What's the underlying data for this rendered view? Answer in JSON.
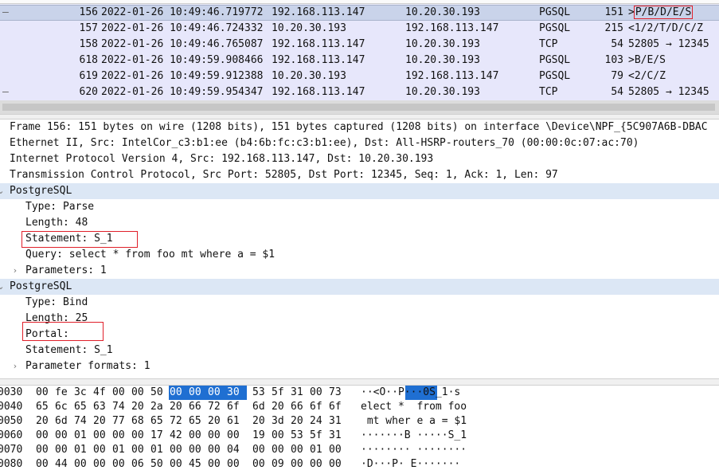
{
  "packet_list": {
    "rows": [
      {
        "mark": "—",
        "no": "156",
        "time": "2022-01-26 10:49:46.719772",
        "src": "192.168.113.147",
        "dst": "10.20.30.193",
        "proto": "PGSQL",
        "len": "151",
        "info_prefix": ">",
        "info_rest": "P/B/D/E/S",
        "selected": true
      },
      {
        "mark": "",
        "no": "157",
        "time": "2022-01-26 10:49:46.724332",
        "src": "10.20.30.193",
        "dst": "192.168.113.147",
        "proto": "PGSQL",
        "len": "215",
        "info_prefix": "",
        "info_rest": "<1/2/T/D/C/Z",
        "selected": false
      },
      {
        "mark": "",
        "no": "158",
        "time": "2022-01-26 10:49:46.765087",
        "src": "192.168.113.147",
        "dst": "10.20.30.193",
        "proto": "TCP",
        "len": "54",
        "info_prefix": "",
        "info_rest": "52805 → 12345",
        "selected": false
      },
      {
        "mark": "",
        "no": "618",
        "time": "2022-01-26 10:49:59.908466",
        "src": "192.168.113.147",
        "dst": "10.20.30.193",
        "proto": "PGSQL",
        "len": "103",
        "info_prefix": "",
        "info_rest": ">B/E/S",
        "selected": false
      },
      {
        "mark": "",
        "no": "619",
        "time": "2022-01-26 10:49:59.912388",
        "src": "10.20.30.193",
        "dst": "192.168.113.147",
        "proto": "PGSQL",
        "len": "79",
        "info_prefix": "",
        "info_rest": "<2/C/Z",
        "selected": false
      },
      {
        "mark": "—",
        "no": "620",
        "time": "2022-01-26 10:49:59.954347",
        "src": "192.168.113.147",
        "dst": "10.20.30.193",
        "proto": "TCP",
        "len": "54",
        "info_prefix": "",
        "info_rest": "52805 → 12345",
        "selected": false
      }
    ]
  },
  "details": {
    "frame": "Frame 156: 151 bytes on wire (1208 bits), 151 bytes captured (1208 bits) on interface \\Device\\NPF_{5C907A6B-DBAC",
    "ethernet": "Ethernet II, Src: IntelCor_c3:b1:ee (b4:6b:fc:c3:b1:ee), Dst: All-HSRP-routers_70 (00:00:0c:07:ac:70)",
    "ip": "Internet Protocol Version 4, Src: 192.168.113.147, Dst: 10.20.30.193",
    "tcp": "Transmission Control Protocol, Src Port: 52805, Dst Port: 12345, Seq: 1, Ack: 1, Len: 97",
    "pg1_title": "PostgreSQL",
    "pg1_type": "Type: Parse",
    "pg1_length": "Length: 48",
    "pg1_statement": "Statement: S_1",
    "pg1_query": "Query: select * from foo mt where a = $1",
    "pg1_params": "Parameters: 1",
    "pg2_title": "PostgreSQL",
    "pg2_type": "Type: Bind",
    "pg2_length": "Length: 25",
    "pg2_portal": "Portal:",
    "pg2_statement": "Statement: S_1",
    "pg2_formats": "Parameter formats: 1",
    "expander_closed": "›",
    "expander_open": "⌄"
  },
  "hex": {
    "rows": [
      {
        "off": "0030",
        "bytes": [
          "00",
          "fe",
          "3c",
          "4f",
          "00",
          "00",
          "50",
          "00",
          "00",
          "00",
          "30",
          "53",
          "5f",
          "31",
          "00",
          "73"
        ],
        "ascii": "··<O··P···0S_1·s"
      },
      {
        "off": "0040",
        "bytes": [
          "65",
          "6c",
          "65",
          "63",
          "74",
          "20",
          "2a",
          "20",
          "66",
          "72",
          "6f",
          "6d",
          "20",
          "66",
          "6f",
          "6f"
        ],
        "ascii": "elect *  from foo"
      },
      {
        "off": "0050",
        "bytes": [
          "20",
          "6d",
          "74",
          "20",
          "77",
          "68",
          "65",
          "72",
          "65",
          "20",
          "61",
          "20",
          "3d",
          "20",
          "24",
          "31"
        ],
        "ascii": " mt wher e a = $1"
      },
      {
        "off": "0060",
        "bytes": [
          "00",
          "00",
          "01",
          "00",
          "00",
          "00",
          "17",
          "42",
          "00",
          "00",
          "00",
          "19",
          "00",
          "53",
          "5f",
          "31"
        ],
        "ascii": "·······B ·····S_1"
      },
      {
        "off": "0070",
        "bytes": [
          "00",
          "00",
          "01",
          "00",
          "01",
          "00",
          "01",
          "00",
          "00",
          "00",
          "04",
          "00",
          "00",
          "00",
          "01",
          "00"
        ],
        "ascii": "········ ········"
      },
      {
        "off": "0080",
        "bytes": [
          "00",
          "44",
          "00",
          "00",
          "00",
          "06",
          "50",
          "00",
          "45",
          "00",
          "00",
          "00",
          "09",
          "00",
          "00",
          "00"
        ],
        "ascii": "·D···P· E·······"
      }
    ]
  },
  "colors": {
    "selection": "#1f6fd2",
    "highlight_box": "#e0202a",
    "section_bg": "#dce7f5"
  }
}
